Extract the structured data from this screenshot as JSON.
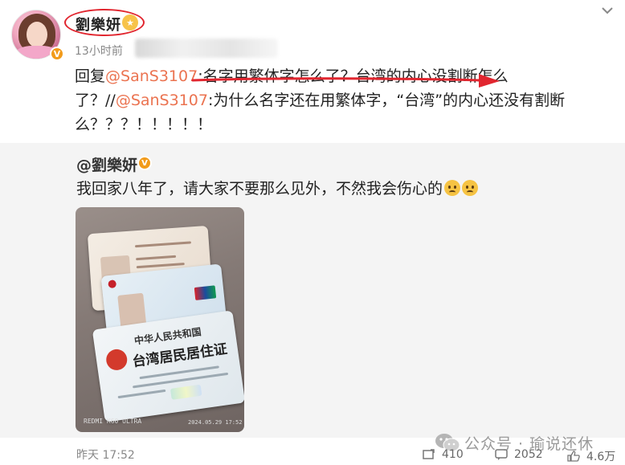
{
  "post": {
    "username": "劉樂妍",
    "time": "13小时前",
    "reply": {
      "prefix": "回复",
      "mention1": "@SanS3107",
      "text1": ":名字用繁体字怎么了？台湾的内心没割断怎么了？//",
      "mention2": "@SanS3107",
      "text2": ":为什么名字还在用繁体字，“台湾”的内心还没有割断么？？？！！！！！"
    }
  },
  "repost": {
    "username": "@劉樂妍",
    "text": "我回家八年了，请大家不要那么见外，不然我会伤心的",
    "photo": {
      "card_title_small": "中华人民共和国",
      "card_title_large": "台湾居民居住证",
      "watermark_left": "REDMI K60 ULTRA",
      "watermark_right": "2024.05.29 17:52"
    }
  },
  "footer": {
    "time": "昨天 17:52",
    "watermark": "公众号 · 瑜说还休",
    "repost_count": "410",
    "comment_count": "2052",
    "like_count": "4.6万"
  },
  "colors": {
    "mention": "#eb7350",
    "annotation_red": "#e1262f",
    "verified": "#f29b1a",
    "repost_bg": "#f4f4f4"
  },
  "icons": {
    "more": "chevron-down-icon",
    "verified": "verified-badge-icon",
    "repost": "repost-icon",
    "comment": "comment-icon",
    "like": "like-icon",
    "wechat": "wechat-icon"
  }
}
